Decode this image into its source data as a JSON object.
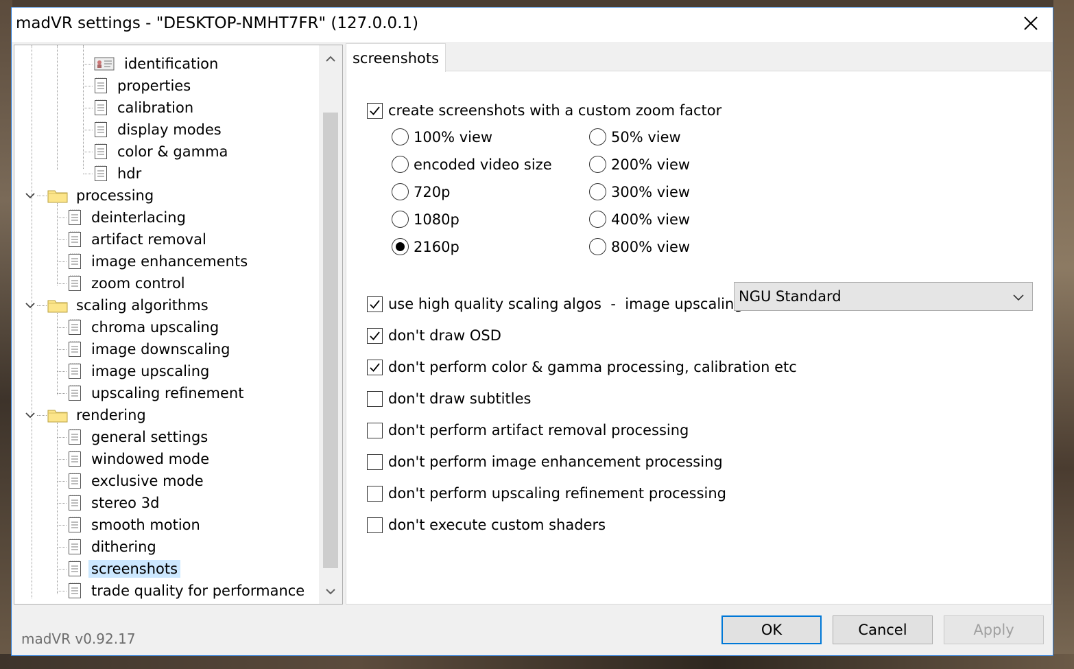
{
  "window": {
    "title": "madVR settings - \"DESKTOP-NMHT7FR\" (127.0.0.1)"
  },
  "tree": {
    "items": [
      {
        "label": "identification",
        "kind": "doc",
        "level": 3,
        "top": 0
      },
      {
        "label": "properties",
        "kind": "doc",
        "level": 3
      },
      {
        "label": "calibration",
        "kind": "doc",
        "level": 3
      },
      {
        "label": "display modes",
        "kind": "doc",
        "level": 3
      },
      {
        "label": "color & gamma",
        "kind": "doc",
        "level": 3
      },
      {
        "label": "hdr",
        "kind": "doc",
        "level": 3
      },
      {
        "label": "processing",
        "kind": "folder",
        "level": 1
      },
      {
        "label": "deinterlacing",
        "kind": "doc",
        "level": 2
      },
      {
        "label": "artifact removal",
        "kind": "doc",
        "level": 2
      },
      {
        "label": "image enhancements",
        "kind": "doc",
        "level": 2
      },
      {
        "label": "zoom control",
        "kind": "doc",
        "level": 2
      },
      {
        "label": "scaling algorithms",
        "kind": "folder",
        "level": 1
      },
      {
        "label": "chroma upscaling",
        "kind": "doc",
        "level": 2
      },
      {
        "label": "image downscaling",
        "kind": "doc",
        "level": 2
      },
      {
        "label": "image upscaling",
        "kind": "doc",
        "level": 2
      },
      {
        "label": "upscaling refinement",
        "kind": "doc",
        "level": 2
      },
      {
        "label": "rendering",
        "kind": "folder",
        "level": 1
      },
      {
        "label": "general settings",
        "kind": "doc",
        "level": 2
      },
      {
        "label": "windowed mode",
        "kind": "doc",
        "level": 2
      },
      {
        "label": "exclusive mode",
        "kind": "doc",
        "level": 2
      },
      {
        "label": "stereo 3d",
        "kind": "doc",
        "level": 2
      },
      {
        "label": "smooth motion",
        "kind": "doc",
        "level": 2
      },
      {
        "label": "dithering",
        "kind": "doc",
        "level": 2
      },
      {
        "label": "screenshots",
        "kind": "doc",
        "level": 2,
        "selected": true
      },
      {
        "label": "trade quality for performance",
        "kind": "doc",
        "level": 2
      }
    ]
  },
  "tab": {
    "label": "screenshots"
  },
  "zoom": {
    "custom_zoom_label": "create screenshots with a custom zoom factor",
    "custom_zoom_checked": true,
    "left_options": [
      "100% view",
      "encoded video size",
      "720p",
      "1080p",
      "2160p"
    ],
    "right_options": [
      "50% view",
      "200% view",
      "300% view",
      "400% view",
      "800% view"
    ],
    "selected": "2160p"
  },
  "options": {
    "hq_scaling_label": "use high quality scaling algos  -  image upscaling:",
    "hq_scaling_checked": true,
    "upscaling_value": "NGU Standard",
    "checks": [
      {
        "label": "don't draw OSD",
        "checked": true
      },
      {
        "label": "don't perform color & gamma processing, calibration etc",
        "checked": true
      },
      {
        "label": "don't draw subtitles",
        "checked": false
      },
      {
        "label": "don't perform artifact removal processing",
        "checked": false
      },
      {
        "label": "don't perform image enhancement processing",
        "checked": false
      },
      {
        "label": "don't perform upscaling refinement processing",
        "checked": false
      },
      {
        "label": "don't execute custom shaders",
        "checked": false
      }
    ]
  },
  "footer": {
    "version": "madVR v0.92.17",
    "ok_label": "OK",
    "cancel_label": "Cancel",
    "apply_label": "Apply"
  },
  "icons": {
    "close": "close-icon",
    "check": "checkmark-icon",
    "doc": "page-icon",
    "folder": "folder-icon",
    "identification": "id-card-icon"
  }
}
